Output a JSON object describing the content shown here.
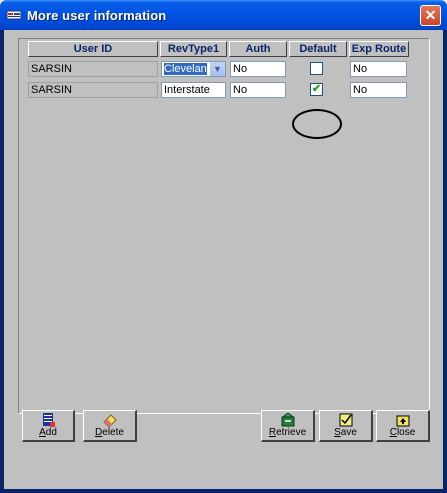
{
  "window": {
    "title": "More user information",
    "close_glyph": "✕"
  },
  "grid": {
    "columns": [
      "User ID",
      "RevType1",
      "Auth",
      "Default",
      "Exp Route"
    ],
    "rows": [
      {
        "user_id": "SARSIN",
        "revtype1": "Clevelan",
        "auth": "No",
        "default": false,
        "exp_route": "No"
      },
      {
        "user_id": "SARSIN",
        "revtype1": "Interstate",
        "auth": "No",
        "default": true,
        "exp_route": "No"
      }
    ],
    "check_glyph": "✔"
  },
  "buttons": {
    "add": "Add",
    "delete": "Delete",
    "retrieve": "Retrieve",
    "save": "Save",
    "close": "Close"
  },
  "icons": {
    "app": "app-icon",
    "add": "add-record-icon",
    "delete": "eraser-icon",
    "retrieve": "retrieve-icon",
    "save": "save-icon",
    "close": "close-folder-icon"
  },
  "colors": {
    "title_bar": "#0055e5",
    "header_text": "#0a246a",
    "selection": "#316ac5",
    "check": "#21a121"
  }
}
